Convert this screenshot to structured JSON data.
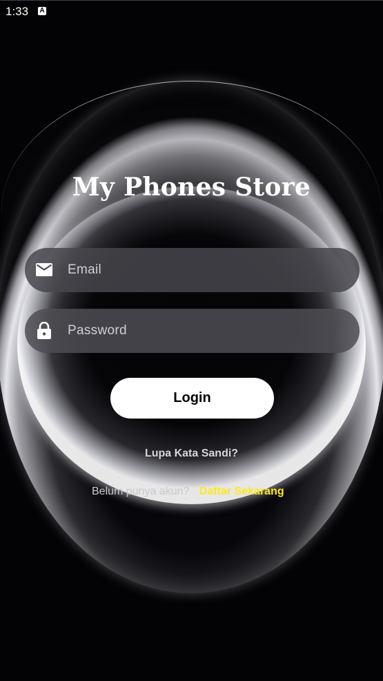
{
  "status_bar": {
    "time": "1:33",
    "notification_icon": "A"
  },
  "title": "My Phones Store",
  "form": {
    "email": {
      "placeholder": "Email",
      "value": "",
      "icon": "mail-icon"
    },
    "password": {
      "placeholder": "Password",
      "value": "",
      "icon": "lock-icon"
    },
    "login_label": "Login",
    "forgot_label": "Lupa Kata Sandi?",
    "register_prompt": "Belum punya akun?",
    "register_link": "Daftar Sekarang"
  },
  "colors": {
    "background": "#030305",
    "field": "#46464c",
    "button": "#ffffff",
    "link": "#ffe81a"
  }
}
